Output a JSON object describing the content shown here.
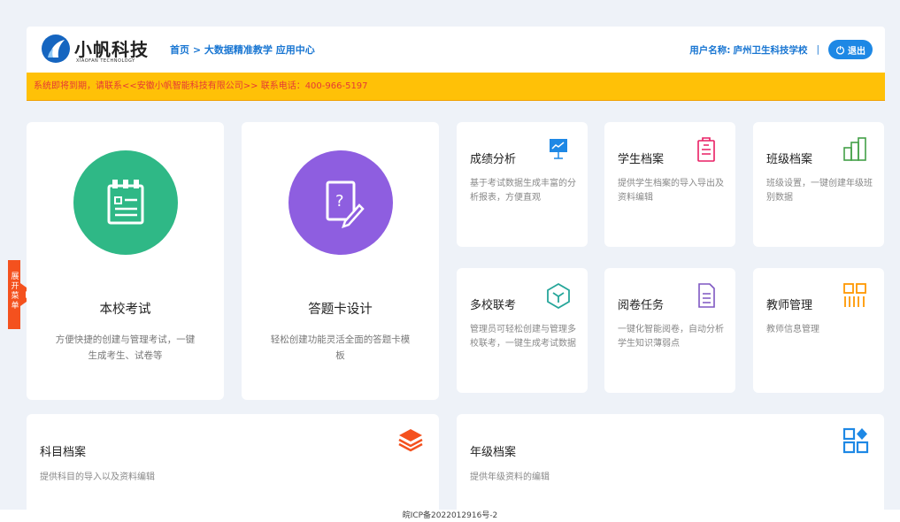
{
  "header": {
    "logo_name": "小帆科技",
    "logo_sub": "XIAOFAN TECHNOLOGY",
    "breadcrumb": [
      "首页",
      "大数据精准教学",
      "应用中心"
    ],
    "user_label": "用户名称:",
    "user_name": "庐州卫生科技学校",
    "separator": "|",
    "logout_label": "退出"
  },
  "notice": "系统即将到期，请联系<<安徽小帆智能科技有限公司>> 联系电话：400-966-5197",
  "side_tab": "展开菜单",
  "big_cards": [
    {
      "title": "本校考试",
      "desc": "方便快捷的创建与管理考试，一键生成考生、试卷等",
      "color": "#2fb886"
    },
    {
      "title": "答题卡设计",
      "desc": "轻松创建功能灵活全面的答题卡模板",
      "color": "#8e5ee0"
    }
  ],
  "small_cards": [
    {
      "title": "成绩分析",
      "desc": "基于考试数据生成丰富的分析报表，方便直观",
      "icon": "presentation-chart-icon",
      "color": "#1e88e5"
    },
    {
      "title": "学生档案",
      "desc": "提供学生档案的导入导出及资料编辑",
      "icon": "clipboard-icon",
      "color": "#e91e63"
    },
    {
      "title": "班级档案",
      "desc": "班级设置，一键创建年级班别数据",
      "icon": "building-icon",
      "color": "#43a047"
    },
    {
      "title": "多校联考",
      "desc": "管理员可轻松创建与管理多校联考，一键生成考试数据",
      "icon": "cube-icon",
      "color": "#26a69a"
    },
    {
      "title": "阅卷任务",
      "desc": "一键化智能阅卷，自动分析学生知识薄弱点",
      "icon": "document-list-icon",
      "color": "#7e57c2"
    },
    {
      "title": "教师管理",
      "desc": "教师信息管理",
      "icon": "teacher-grid-icon",
      "color": "#ff9800"
    }
  ],
  "wide_cards": [
    {
      "title": "科目档案",
      "desc": "提供科目的导入以及资料编辑",
      "icon": "layers-icon",
      "color": "#f4511e"
    },
    {
      "title": "年级档案",
      "desc": "提供年级资料的编辑",
      "icon": "apps-diamond-icon",
      "color": "#1e88e5"
    }
  ],
  "footer": "皖ICP备2022012916号-2"
}
